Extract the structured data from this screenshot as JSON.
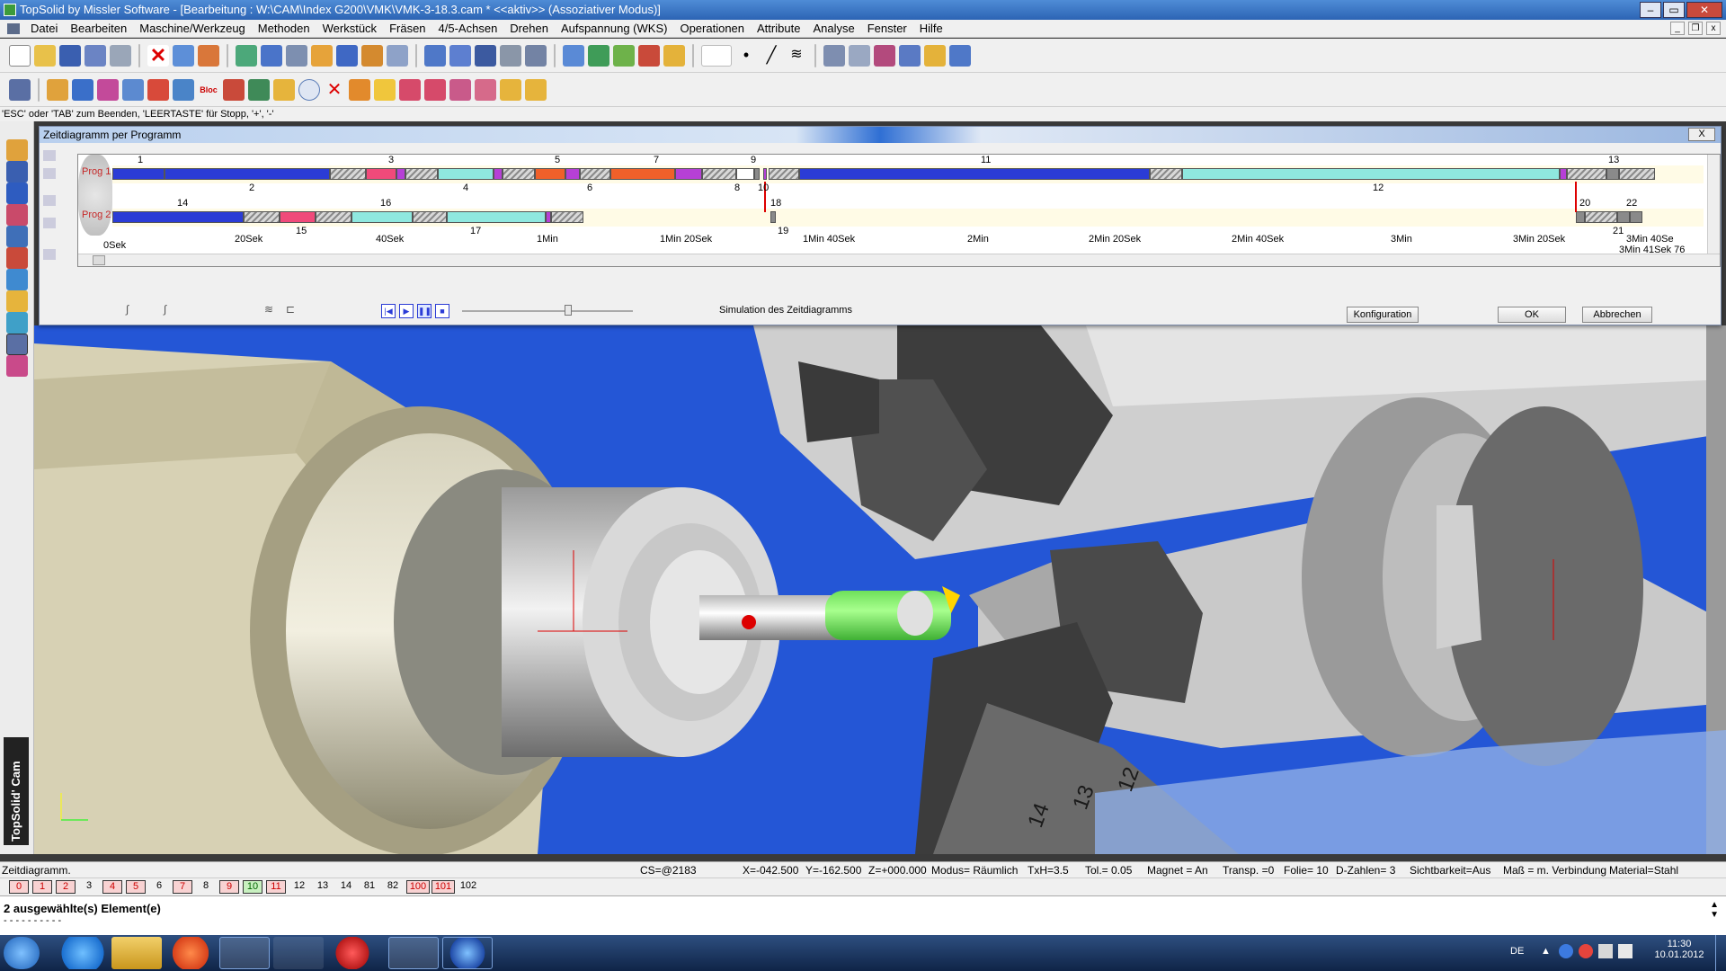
{
  "window": {
    "title": "TopSolid by Missler Software - [Bearbeitung : W:\\CAM\\Index G200\\VMK\\VMK-3-18.3.cam *  <<aktiv>> (Assoziativer Modus)]"
  },
  "menu": [
    "Datei",
    "Bearbeiten",
    "Maschine/Werkzeug",
    "Methoden",
    "Werkstück",
    "Fräsen",
    "4/5-Achsen",
    "Drehen",
    "Aufspannung (WKS)",
    "Operationen",
    "Attribute",
    "Analyse",
    "Fenster",
    "Hilfe"
  ],
  "hint": "'ESC' oder 'TAB' zum Beenden, 'LEERTASTE' für Stopp, '+', '-'",
  "dialog": {
    "title": "Zeitdiagramm per Programm",
    "close": "X",
    "prog1": "Prog 1",
    "prog2": "Prog 2",
    "p1_top": [
      "1",
      "3",
      "5",
      "7",
      "9",
      "11",
      "13"
    ],
    "p1_bottom": [
      "2",
      "4",
      "6",
      "8",
      "10",
      "12"
    ],
    "p2_top": [
      "14",
      "16",
      "18",
      "20",
      "22"
    ],
    "p2_bottom": [
      "15",
      "17",
      "19",
      "21"
    ],
    "ticks": [
      "0Sek",
      "20Sek",
      "40Sek",
      "1Min",
      "1Min 20Sek",
      "1Min 40Sek",
      "2Min",
      "2Min 20Sek",
      "2Min 40Sek",
      "3Min",
      "3Min 20Sek",
      "3Min 40Se"
    ],
    "end_time": "3Min 41Sek 76",
    "sim_label": "Simulation des Zeitdiagramms",
    "config": "Konfiguration",
    "ok": "OK",
    "cancel": "Abbrechen"
  },
  "viewport": {
    "tool_numbers": [
      "13",
      "14",
      "12"
    ]
  },
  "status": {
    "mode": "Zeitdiagramm.",
    "cs": "CS=@2183",
    "x": "X=-042.500",
    "y": "Y=-162.500",
    "z": "Z=+000.000",
    "modus": "Modus= Räumlich",
    "txh": "TxH=3.5",
    "tol": "Tol.= 0.05",
    "magnet": "Magnet = An",
    "transp": "Transp. =0",
    "folie": "Folie= 10",
    "dzahlen": "D-Zahlen= 3",
    "sicht": "Sichtbarkeit=Aus",
    "mass": "Maß = m. Verbindung",
    "material": "Material=Stahl"
  },
  "layers": [
    "0",
    "1",
    "2",
    "3",
    "4",
    "5",
    "6",
    "7",
    "8",
    "9",
    "10",
    "11",
    "12",
    "13",
    "14",
    "81",
    "82",
    "100",
    "101",
    "102"
  ],
  "command": {
    "line1": "2 ausgewählte(s) Element(e)",
    "line2": "- - - - - - - - - -"
  },
  "brand": "TopSolid' Cam",
  "tray": {
    "lang": "DE",
    "time": "11:30",
    "date": "10.01.2012"
  }
}
